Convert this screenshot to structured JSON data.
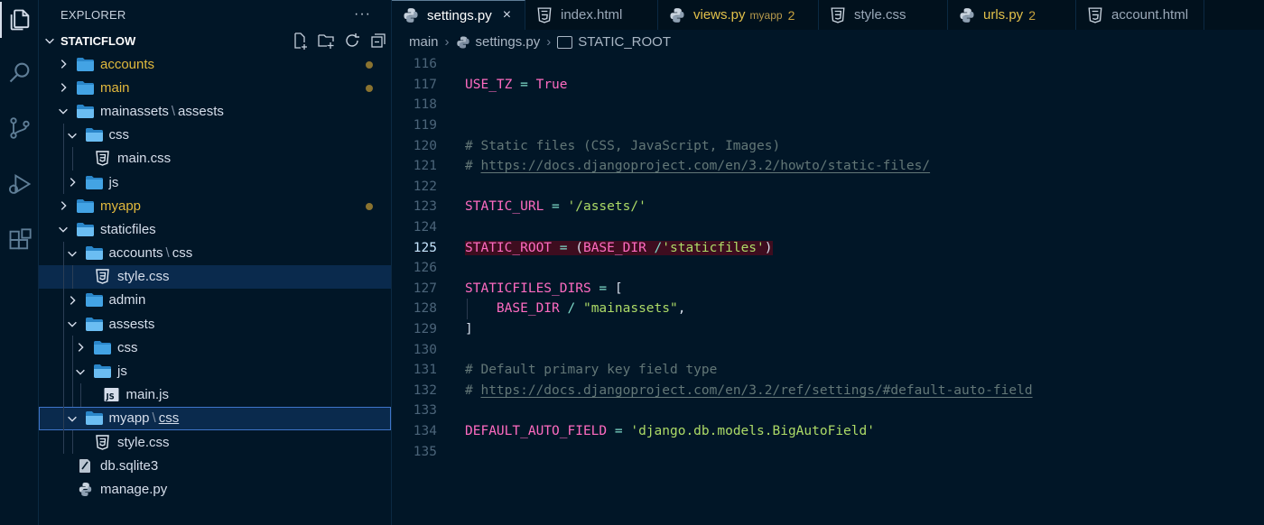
{
  "activity_bar": {
    "items": [
      {
        "name": "explorer-icon",
        "active": true
      },
      {
        "name": "search-icon",
        "active": false
      },
      {
        "name": "source-control-icon",
        "active": false
      },
      {
        "name": "run-debug-icon",
        "active": false
      },
      {
        "name": "extensions-icon",
        "active": false
      }
    ]
  },
  "sidebar": {
    "title": "EXPLORER",
    "more": "···",
    "workspace": "STATICFLOW",
    "tree": [
      {
        "label": "accounts",
        "kind": "folder",
        "open": false,
        "depth": 0,
        "modified": true
      },
      {
        "label": "main",
        "kind": "folder",
        "open": false,
        "depth": 0,
        "modified": true
      },
      {
        "label": "mainassets",
        "label2": "assests",
        "kind": "folder",
        "open": true,
        "depth": 0
      },
      {
        "label": "css",
        "kind": "folder",
        "open": true,
        "depth": 1
      },
      {
        "label": "main.css",
        "kind": "css",
        "depth": 2
      },
      {
        "label": "js",
        "kind": "folder",
        "open": false,
        "depth": 1
      },
      {
        "label": "myapp",
        "kind": "folder",
        "open": false,
        "depth": 0,
        "modified": true
      },
      {
        "label": "staticfiles",
        "kind": "folder",
        "open": true,
        "depth": 0
      },
      {
        "label": "accounts",
        "label2": "css",
        "kind": "folder",
        "open": true,
        "depth": 1
      },
      {
        "label": "style.css",
        "kind": "css",
        "depth": 2,
        "selected": true
      },
      {
        "label": "admin",
        "kind": "folder",
        "open": false,
        "depth": 1
      },
      {
        "label": "assests",
        "kind": "folder",
        "open": true,
        "depth": 1
      },
      {
        "label": "css",
        "kind": "folder",
        "open": false,
        "depth": 2
      },
      {
        "label": "js",
        "kind": "folder",
        "open": true,
        "depth": 2
      },
      {
        "label": "main.js",
        "kind": "js",
        "depth": 3
      },
      {
        "label": "myapp",
        "label2": "css",
        "kind": "folder",
        "open": true,
        "depth": 1,
        "focused": true
      },
      {
        "label": "style.css",
        "kind": "css",
        "depth": 2
      },
      {
        "label": "db.sqlite3",
        "kind": "db",
        "depth": 0
      },
      {
        "label": "manage.py",
        "kind": "py",
        "depth": 0
      }
    ]
  },
  "tabs": [
    {
      "label": "settings.py",
      "icon": "python",
      "active": true,
      "close": "×"
    },
    {
      "label": "index.html",
      "icon": "html"
    },
    {
      "label": "views.py",
      "icon": "python",
      "modified": true,
      "sub": "myapp",
      "count": "2"
    },
    {
      "label": "style.css",
      "icon": "css"
    },
    {
      "label": "urls.py",
      "icon": "python",
      "modified": true,
      "count": "2"
    },
    {
      "label": "account.html",
      "icon": "html"
    }
  ],
  "breadcrumb": {
    "items": [
      "main",
      "settings.py",
      "STATIC_ROOT"
    ]
  },
  "editor": {
    "current_line": "125",
    "lines": [
      {
        "n": "116",
        "tokens": []
      },
      {
        "n": "117",
        "tokens": [
          [
            "USE_TZ",
            "var"
          ],
          [
            " = ",
            "op"
          ],
          [
            "True",
            "bool"
          ]
        ]
      },
      {
        "n": "118",
        "tokens": []
      },
      {
        "n": "119",
        "tokens": []
      },
      {
        "n": "120",
        "tokens": [
          [
            "# Static files (CSS, JavaScript, Images)",
            "cmt"
          ]
        ]
      },
      {
        "n": "121",
        "tokens": [
          [
            "# ",
            "cmt"
          ],
          [
            "https://docs.djangoproject.com/en/3.2/howto/static-files/",
            "url"
          ]
        ]
      },
      {
        "n": "122",
        "tokens": []
      },
      {
        "n": "123",
        "tokens": [
          [
            "STATIC_URL",
            "var"
          ],
          [
            " = ",
            "op"
          ],
          [
            "'/assets/'",
            "str"
          ]
        ]
      },
      {
        "n": "124",
        "tokens": []
      },
      {
        "n": "125",
        "highlight": true,
        "tokens": [
          [
            "STATIC_ROOT",
            "var"
          ],
          [
            " = ",
            "op"
          ],
          [
            "(",
            "punc"
          ],
          [
            "BASE_DIR",
            "name"
          ],
          [
            " /",
            "op"
          ],
          [
            "'staticfiles'",
            "str"
          ],
          [
            ")",
            "punc"
          ]
        ]
      },
      {
        "n": "126",
        "tokens": []
      },
      {
        "n": "127",
        "tokens": [
          [
            "STATICFILES_DIRS",
            "var"
          ],
          [
            " = ",
            "op"
          ],
          [
            "[",
            "punc"
          ]
        ]
      },
      {
        "n": "128",
        "tokens": [
          [
            "    ",
            "punc"
          ],
          [
            "BASE_DIR",
            "name"
          ],
          [
            " / ",
            "op"
          ],
          [
            "\"mainassets\"",
            "str"
          ],
          [
            ",",
            "punc"
          ]
        ]
      },
      {
        "n": "129",
        "tokens": [
          [
            "]",
            "punc"
          ]
        ]
      },
      {
        "n": "130",
        "tokens": []
      },
      {
        "n": "131",
        "tokens": [
          [
            "# Default primary key field type",
            "cmt"
          ]
        ]
      },
      {
        "n": "132",
        "tokens": [
          [
            "# ",
            "cmt"
          ],
          [
            "https://docs.djangoproject.com/en/3.2/ref/settings/#default-auto-field",
            "url"
          ]
        ]
      },
      {
        "n": "133",
        "tokens": []
      },
      {
        "n": "134",
        "tokens": [
          [
            "DEFAULT_AUTO_FIELD",
            "var"
          ],
          [
            " = ",
            "op"
          ],
          [
            "'django.db.models.BigAutoField'",
            "str"
          ]
        ]
      },
      {
        "n": "135",
        "tokens": []
      }
    ]
  },
  "colors": {
    "background": "#011627",
    "modified_text": "#e2b93d",
    "selection": "#0a2a4d",
    "focus_border": "#3f75c9",
    "line_highlight": "#3e0d1f"
  }
}
